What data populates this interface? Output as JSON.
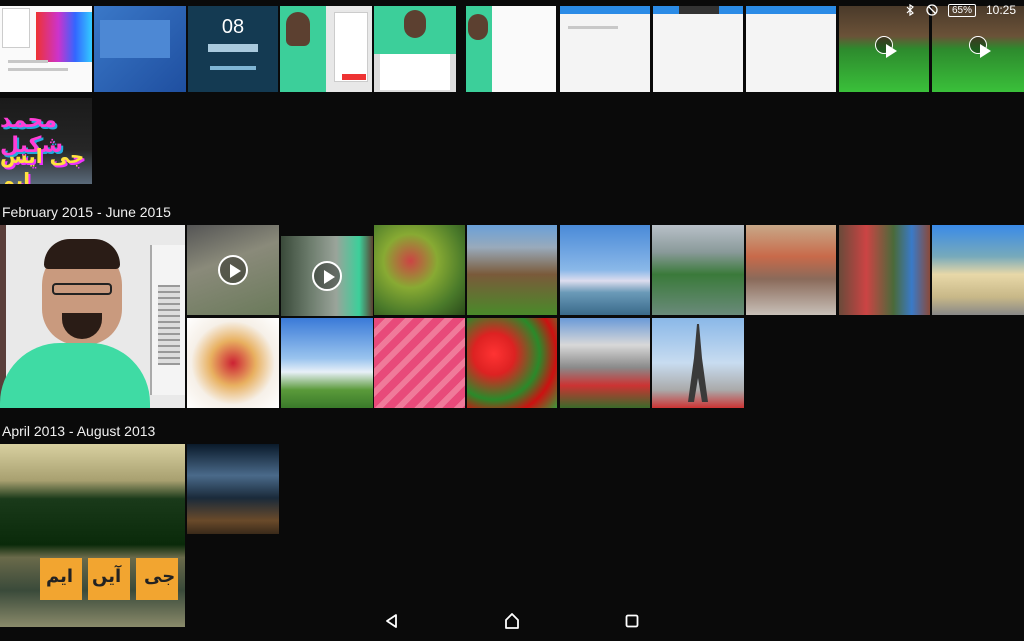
{
  "status_bar": {
    "battery": "65%",
    "time": "10:25"
  },
  "sections": [
    {
      "title": "February 2015 - June 2015"
    },
    {
      "title": "April 2013 - August 2013"
    }
  ],
  "lock_tile": {
    "time": "08",
    "date": ""
  },
  "urdu_text": {
    "top_lines": "محمد شکیل",
    "bottom_line": "جی ایس ایم"
  },
  "photo_text": {
    "overlay_letters": [
      "جی",
      "آیں",
      "ایم"
    ]
  },
  "colors": {
    "background": "#0a0a0a",
    "accent": "#2b8be6",
    "tile_fallback": "#333333"
  },
  "icons": {
    "bluetooth": "bluetooth-icon",
    "dnd": "do-not-disturb-icon",
    "play": "play-icon",
    "back": "back-icon",
    "home": "home-icon",
    "recents": "recents-icon"
  }
}
